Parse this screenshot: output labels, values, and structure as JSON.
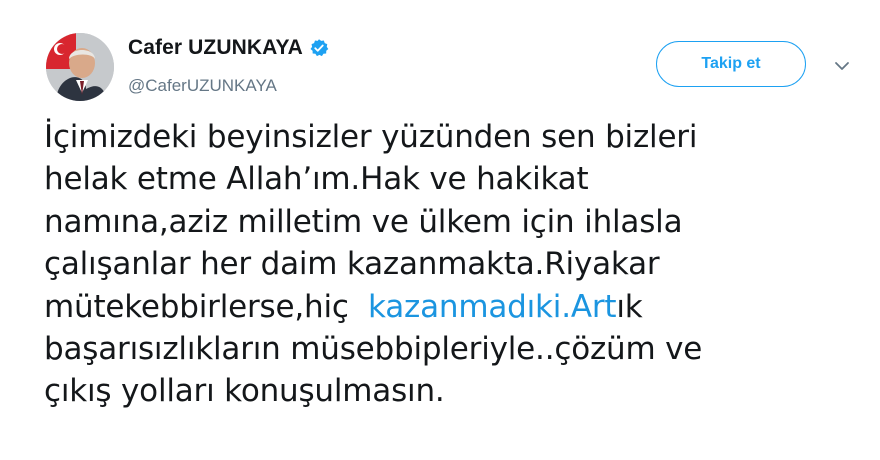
{
  "author": {
    "display_name": "Cafer UZUNKAYA",
    "handle": "@CaferUZUNKAYA",
    "verified": true
  },
  "actions": {
    "follow_label": "Takip et"
  },
  "icons": {
    "verified": "verified-badge-icon",
    "more": "chevron-down-icon"
  },
  "colors": {
    "accent": "#1da1f2",
    "link": "#1b95e0",
    "text": "#14171a",
    "secondary": "#657786"
  },
  "tweet": {
    "lines": [
      "İçimizdeki beyinsizler yüzünden sen bizleri",
      "helak etme Allah’ım.Hak ve hakikat",
      "namına,aziz milletim ve ülkem için ihlasla",
      "çalışanlar her daim kazanmakta.Riyakar"
    ],
    "line5_before": "mütekebbirlerse,hiç  ",
    "line5_link": "kazanmadıki.Art",
    "line5_after": "ık",
    "lines_after": [
      "başarısızlıkların müsebbipleriyle..çözüm ve",
      "çıkış yolları konuşulmasın."
    ]
  }
}
